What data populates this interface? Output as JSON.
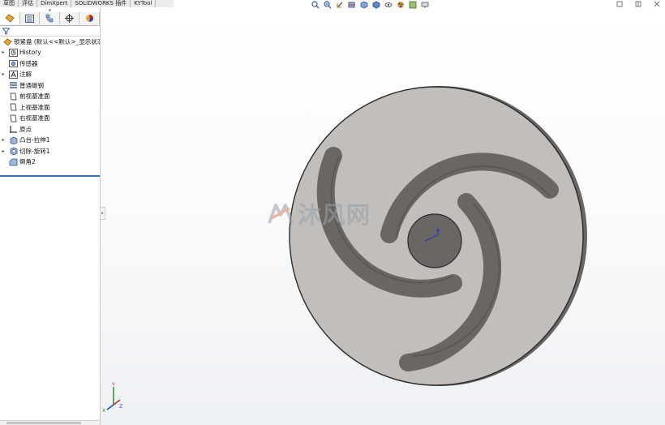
{
  "command_tabs": [
    "草图",
    "评估",
    "DimXpert",
    "SOLIDWORKS 插件",
    "KYTool"
  ],
  "hud_icons": [
    "zoom-to-fit-icon",
    "zoom-area-icon",
    "previous-view-icon",
    "section-view-icon",
    "view-orientation-icon",
    "display-style-icon",
    "hide-show-icon",
    "appearance-icon",
    "scene-icon",
    "display-settings-icon"
  ],
  "window_controls": [
    "restore-icon",
    "tile-icon",
    "close-icon"
  ],
  "manager_tabs": [
    "featuremanager-tab",
    "propertymanager-tab",
    "configurationmanager-tab",
    "dimxpert-tab",
    "display-manager-tab"
  ],
  "tree": {
    "root_label": "锁紧盘 (默认<<默认>_显示状态",
    "items": [
      {
        "label": "History",
        "expand": true,
        "icon": "history-icon"
      },
      {
        "label": "传感器",
        "expand": false,
        "icon": "sensor-icon"
      },
      {
        "label": "注解",
        "expand": true,
        "icon": "annotation-icon"
      },
      {
        "label": "普通碳钢",
        "expand": false,
        "icon": "material-icon"
      },
      {
        "label": "前视基准面",
        "expand": false,
        "icon": "plane-icon"
      },
      {
        "label": "上视基准面",
        "expand": false,
        "icon": "plane-icon"
      },
      {
        "label": "右视基准面",
        "expand": false,
        "icon": "plane-icon"
      },
      {
        "label": "原点",
        "expand": false,
        "icon": "origin-icon"
      },
      {
        "label": "凸台-拉伸1",
        "expand": true,
        "icon": "extrude-icon"
      },
      {
        "label": "切除-旋转1",
        "expand": true,
        "icon": "revolve-cut-icon"
      },
      {
        "label": "倒角2",
        "expand": false,
        "icon": "chamfer-icon"
      }
    ]
  },
  "watermark": {
    "text": "沐风网"
  },
  "triad": {
    "x": "X",
    "y": "Y",
    "z": "Z"
  },
  "colors": {
    "part_face": "#c2bebb",
    "part_edge": "#2a2a2a",
    "rollback_bar": "#3a6fb4"
  }
}
